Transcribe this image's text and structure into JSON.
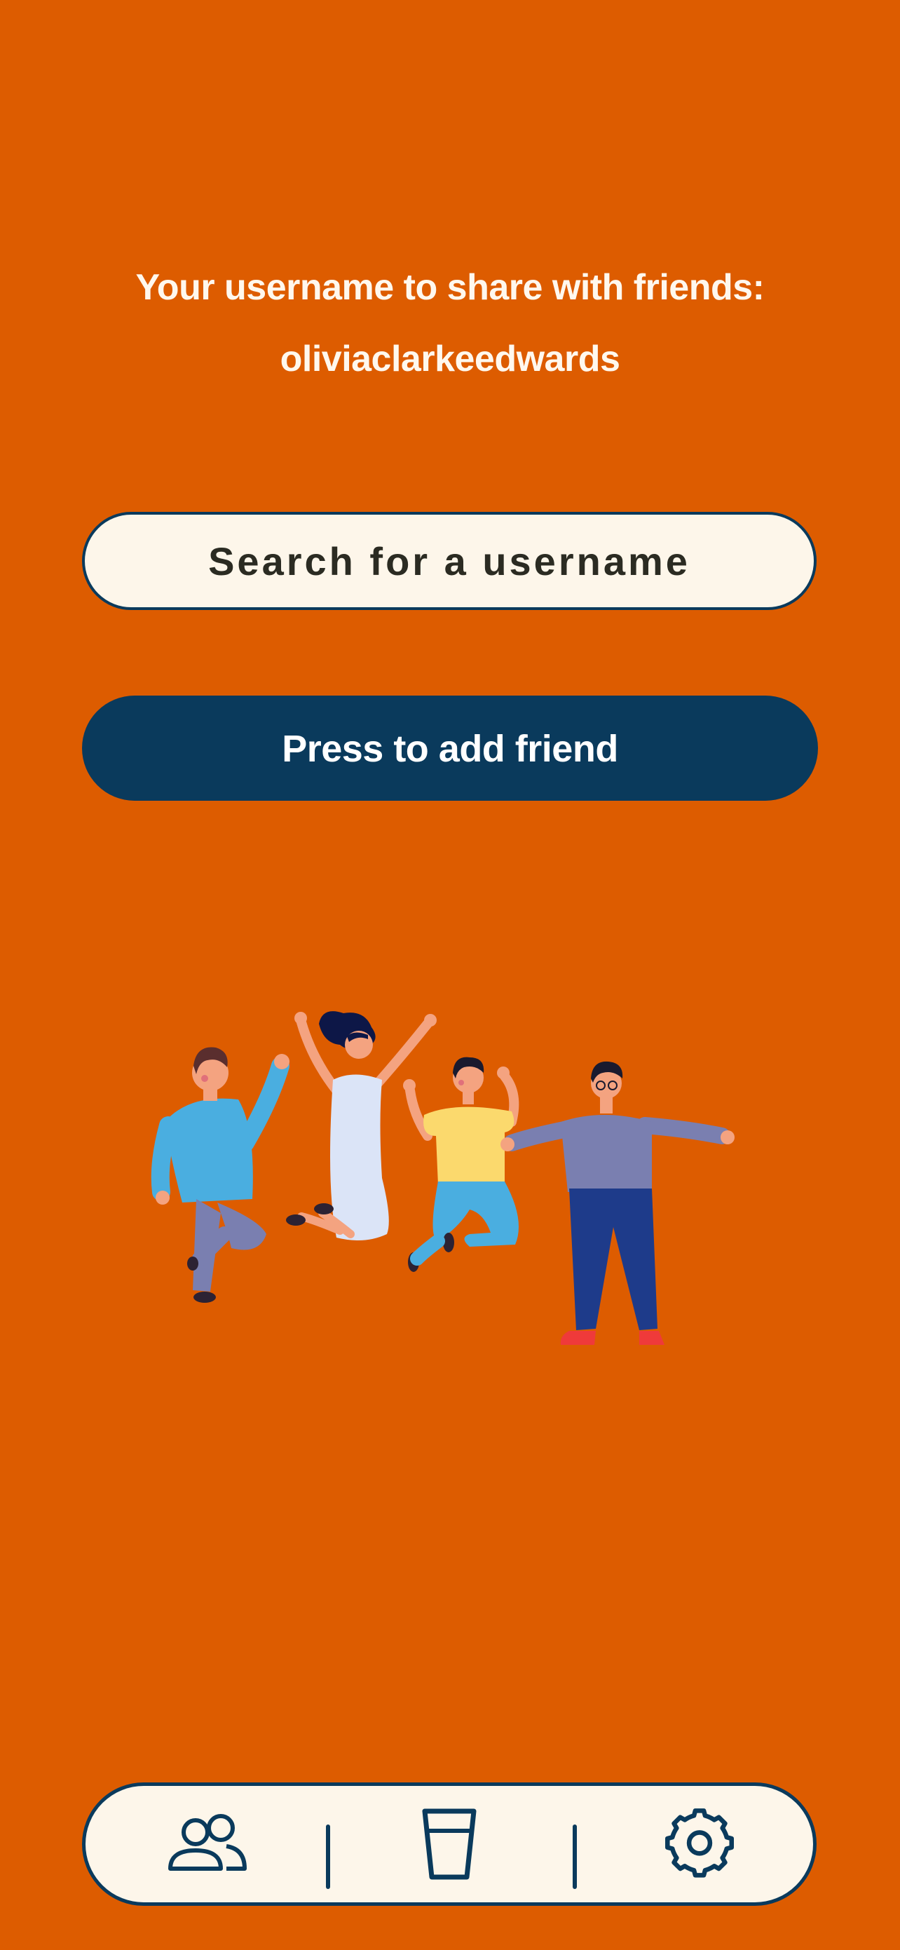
{
  "header": {
    "share_title": "Your username to share with friends:",
    "username": "oliviaclarkeedwards"
  },
  "search": {
    "placeholder": "Search for a username",
    "value": ""
  },
  "add_button": {
    "label": "Press to add friend"
  },
  "illustration": {
    "icon": "people-celebrating-illustration"
  },
  "nav": {
    "items": [
      {
        "icon": "friends-icon"
      },
      {
        "icon": "cup-icon"
      },
      {
        "icon": "gear-icon"
      }
    ]
  },
  "colors": {
    "background": "#dd5c00",
    "accent_dark": "#0a3a5c",
    "surface": "#fdf6ea",
    "text_light": "#fff8ee"
  }
}
